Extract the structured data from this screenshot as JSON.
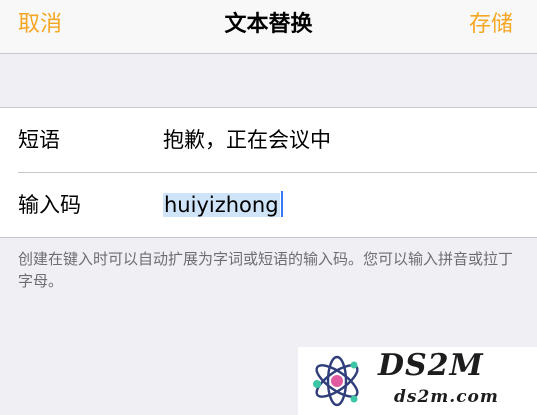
{
  "navbar": {
    "cancel_label": "取消",
    "title": "文本替换",
    "save_label": "存储"
  },
  "form": {
    "phrase_label": "短语",
    "phrase_value": "抱歉，正在会议中",
    "shortcut_label": "输入码",
    "shortcut_value": "huiyizhong"
  },
  "footer": {
    "note": "创建在键入时可以自动扩展为字词或短语的输入码。您可以输入拼音或拉丁字母。"
  },
  "watermark": {
    "title": "DS2M",
    "url": "ds2m.com"
  },
  "colors": {
    "accent": "#f5a623",
    "background": "#efeff4",
    "cell": "#ffffff",
    "separator": "#c8c7cc",
    "footer_text": "#6d6d72",
    "selection": "#cfe3f9",
    "cursor": "#3478f6"
  }
}
